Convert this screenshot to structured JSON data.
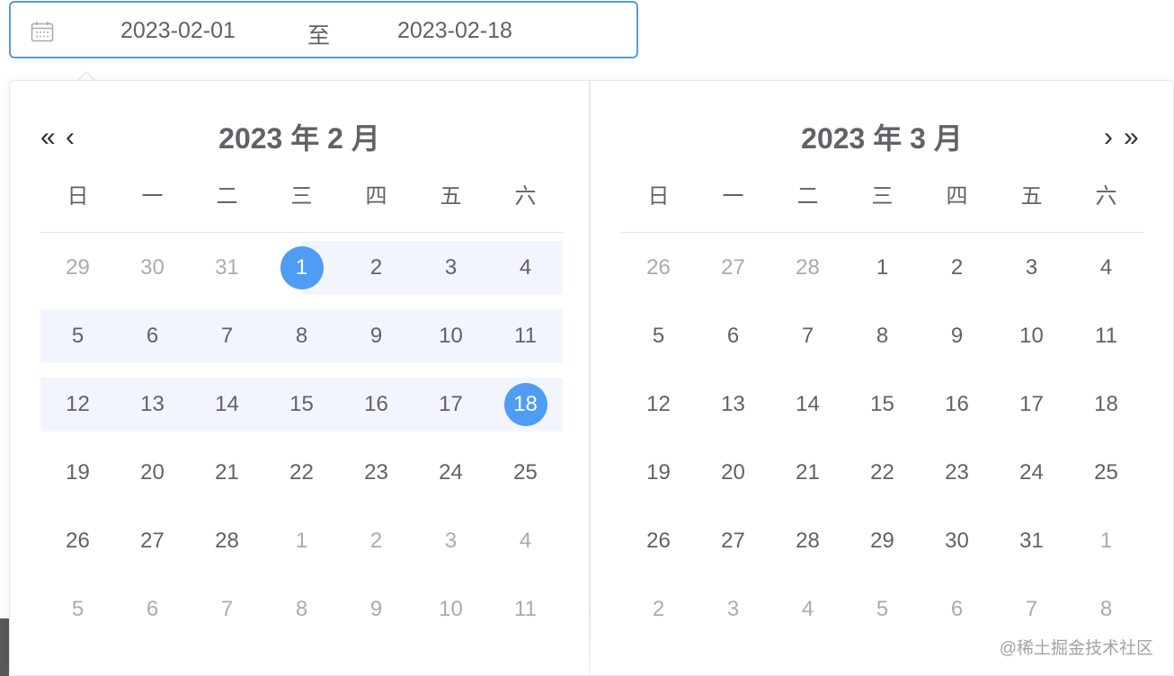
{
  "range_input": {
    "icon": "calendar-icon",
    "start": "2023-02-01",
    "separator": "至",
    "end": "2023-02-18"
  },
  "panels": [
    {
      "title": "2023 年 2 月",
      "nav": [
        "«",
        "‹"
      ],
      "weekdays": [
        "日",
        "一",
        "二",
        "三",
        "四",
        "五",
        "六"
      ],
      "weeks": [
        [
          {
            "d": "29",
            "o": true
          },
          {
            "d": "30",
            "o": true
          },
          {
            "d": "31",
            "o": true
          },
          {
            "d": "1",
            "s": true
          },
          {
            "d": "2"
          },
          {
            "d": "3"
          },
          {
            "d": "4"
          }
        ],
        [
          {
            "d": "5"
          },
          {
            "d": "6"
          },
          {
            "d": "7"
          },
          {
            "d": "8"
          },
          {
            "d": "9"
          },
          {
            "d": "10"
          },
          {
            "d": "11"
          }
        ],
        [
          {
            "d": "12"
          },
          {
            "d": "13"
          },
          {
            "d": "14"
          },
          {
            "d": "15"
          },
          {
            "d": "16"
          },
          {
            "d": "17"
          },
          {
            "d": "18",
            "s": true
          }
        ],
        [
          {
            "d": "19"
          },
          {
            "d": "20"
          },
          {
            "d": "21"
          },
          {
            "d": "22"
          },
          {
            "d": "23"
          },
          {
            "d": "24"
          },
          {
            "d": "25"
          }
        ],
        [
          {
            "d": "26"
          },
          {
            "d": "27"
          },
          {
            "d": "28"
          },
          {
            "d": "1",
            "o": true
          },
          {
            "d": "2",
            "o": true
          },
          {
            "d": "3",
            "o": true
          },
          {
            "d": "4",
            "o": true
          }
        ],
        [
          {
            "d": "5",
            "o": true
          },
          {
            "d": "6",
            "o": true
          },
          {
            "d": "7",
            "o": true
          },
          {
            "d": "8",
            "o": true
          },
          {
            "d": "9",
            "o": true
          },
          {
            "d": "10",
            "o": true
          },
          {
            "d": "11",
            "o": true
          }
        ]
      ],
      "in_range_weeks": [
        0,
        1,
        2
      ]
    },
    {
      "title": "2023 年 3 月",
      "nav": [
        "›",
        "»"
      ],
      "weekdays": [
        "日",
        "一",
        "二",
        "三",
        "四",
        "五",
        "六"
      ],
      "weeks": [
        [
          {
            "d": "26",
            "o": true
          },
          {
            "d": "27",
            "o": true
          },
          {
            "d": "28",
            "o": true
          },
          {
            "d": "1"
          },
          {
            "d": "2"
          },
          {
            "d": "3"
          },
          {
            "d": "4"
          }
        ],
        [
          {
            "d": "5"
          },
          {
            "d": "6"
          },
          {
            "d": "7"
          },
          {
            "d": "8"
          },
          {
            "d": "9"
          },
          {
            "d": "10"
          },
          {
            "d": "11"
          }
        ],
        [
          {
            "d": "12"
          },
          {
            "d": "13"
          },
          {
            "d": "14"
          },
          {
            "d": "15"
          },
          {
            "d": "16"
          },
          {
            "d": "17"
          },
          {
            "d": "18"
          }
        ],
        [
          {
            "d": "19"
          },
          {
            "d": "20"
          },
          {
            "d": "21"
          },
          {
            "d": "22"
          },
          {
            "d": "23"
          },
          {
            "d": "24"
          },
          {
            "d": "25"
          }
        ],
        [
          {
            "d": "26"
          },
          {
            "d": "27"
          },
          {
            "d": "28"
          },
          {
            "d": "29"
          },
          {
            "d": "30"
          },
          {
            "d": "31"
          },
          {
            "d": "1",
            "o": true
          }
        ],
        [
          {
            "d": "2",
            "o": true
          },
          {
            "d": "3",
            "o": true
          },
          {
            "d": "4",
            "o": true
          },
          {
            "d": "5",
            "o": true
          },
          {
            "d": "6",
            "o": true
          },
          {
            "d": "7",
            "o": true
          },
          {
            "d": "8",
            "o": true
          }
        ]
      ],
      "in_range_weeks": []
    }
  ],
  "colors": {
    "accent": "#4f9cf5",
    "range_band": "#f2f6fc",
    "input_border": "#5b9bdf"
  },
  "watermark": "@稀土掘金技术社区"
}
